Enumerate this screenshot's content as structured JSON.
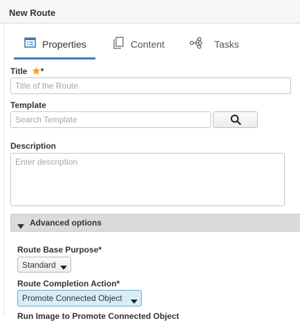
{
  "window": {
    "title": "New Route"
  },
  "tabs": [
    {
      "label": "Properties",
      "icon": "properties-icon",
      "active": true
    },
    {
      "label": "Content",
      "icon": "content-icon",
      "active": false
    },
    {
      "label": "Tasks",
      "icon": "tasks-icon",
      "active": false
    }
  ],
  "form": {
    "title": {
      "label": "Title",
      "required_mark": "*",
      "placeholder": "Title of the Route",
      "value": ""
    },
    "template": {
      "label": "Template",
      "placeholder": "Search Template",
      "value": ""
    },
    "description": {
      "label": "Description",
      "placeholder": "Enter description",
      "value": ""
    }
  },
  "advanced": {
    "label": "Advanced options",
    "route_base_purpose": {
      "label": "Route Base Purpose*",
      "selected": "Standard"
    },
    "route_completion_action": {
      "label": "Route Completion Action*",
      "selected": "Promote Connected Object"
    },
    "next_label_partial": "Run Image to Promote Connected Object"
  },
  "colors": {
    "accent": "#3f7cb8",
    "star": "#f0a020",
    "highlight_bg": "#d8edf5",
    "advanced_bar": "#d9dcdd"
  }
}
